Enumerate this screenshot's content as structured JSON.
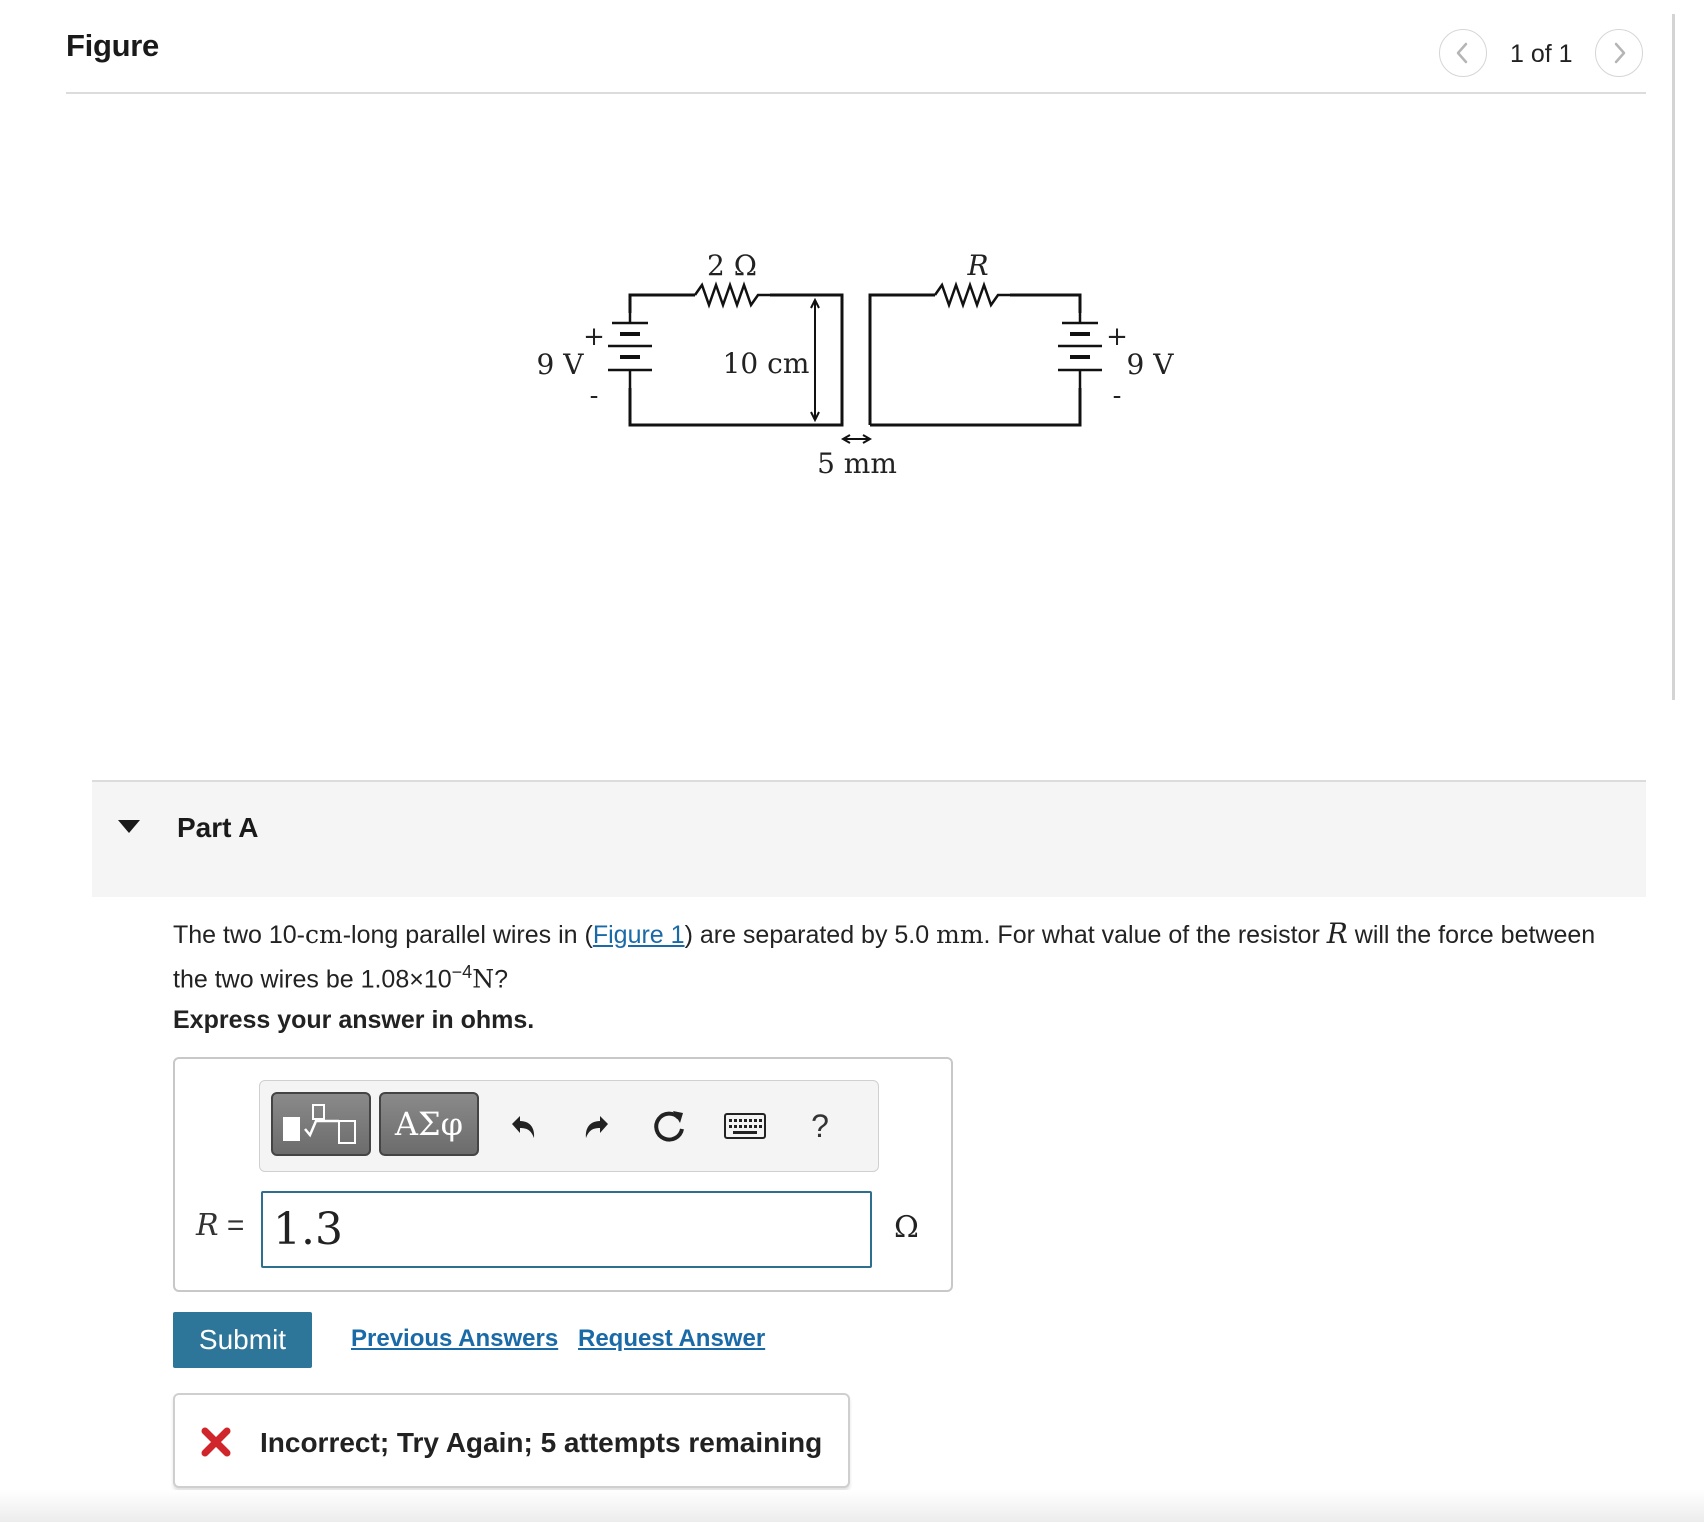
{
  "figure": {
    "title": "Figure",
    "pager": {
      "count_text": "1 of 1"
    }
  },
  "circuit": {
    "left_resistor_label": "2 Ω",
    "right_resistor_label": "R",
    "left_battery_label": "9 V",
    "right_battery_label": "9 V",
    "wire_length_label": "10 cm",
    "separation_label": "5 mm",
    "plus_sign": "+",
    "minus_sign": "-"
  },
  "part": {
    "title": "Part A"
  },
  "question": {
    "text_1": "The two 10-",
    "unit_cm": "cm",
    "text_2": "-long parallel wires in (",
    "figure_link": "Figure 1",
    "text_3": ") are separated by 5.0 ",
    "unit_mm": "mm",
    "text_4": ". For what value of the resistor ",
    "var_R": "R",
    "text_5": " will the force between the two wires be 1.08×10",
    "exponent": "−4",
    "unit_N": "N",
    "text_6": "?"
  },
  "instruction": "Express your answer in ohms.",
  "toolbar": {
    "greek_label": "ΑΣφ",
    "help_label": "?"
  },
  "answer": {
    "variable": "R",
    "equals": " =",
    "value": "1.3",
    "unit": "Ω"
  },
  "actions": {
    "submit_label": "Submit",
    "previous_answers_label": "Previous Answers",
    "request_answer_label": "Request Answer"
  },
  "feedback": {
    "message": "Incorrect; Try Again; 5 attempts remaining",
    "icon": "x-icon",
    "color": "#d0262b"
  }
}
